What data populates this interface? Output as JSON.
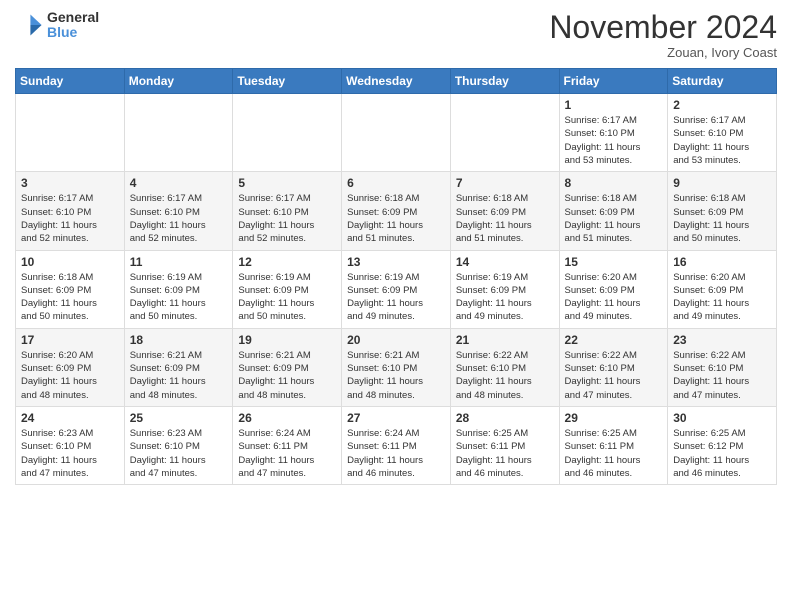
{
  "header": {
    "logo_general": "General",
    "logo_blue": "Blue",
    "month_title": "November 2024",
    "location": "Zouan, Ivory Coast"
  },
  "days_of_week": [
    "Sunday",
    "Monday",
    "Tuesday",
    "Wednesday",
    "Thursday",
    "Friday",
    "Saturday"
  ],
  "weeks": [
    [
      {
        "day": "",
        "info": ""
      },
      {
        "day": "",
        "info": ""
      },
      {
        "day": "",
        "info": ""
      },
      {
        "day": "",
        "info": ""
      },
      {
        "day": "",
        "info": ""
      },
      {
        "day": "1",
        "info": "Sunrise: 6:17 AM\nSunset: 6:10 PM\nDaylight: 11 hours\nand 53 minutes."
      },
      {
        "day": "2",
        "info": "Sunrise: 6:17 AM\nSunset: 6:10 PM\nDaylight: 11 hours\nand 53 minutes."
      }
    ],
    [
      {
        "day": "3",
        "info": "Sunrise: 6:17 AM\nSunset: 6:10 PM\nDaylight: 11 hours\nand 52 minutes."
      },
      {
        "day": "4",
        "info": "Sunrise: 6:17 AM\nSunset: 6:10 PM\nDaylight: 11 hours\nand 52 minutes."
      },
      {
        "day": "5",
        "info": "Sunrise: 6:17 AM\nSunset: 6:10 PM\nDaylight: 11 hours\nand 52 minutes."
      },
      {
        "day": "6",
        "info": "Sunrise: 6:18 AM\nSunset: 6:09 PM\nDaylight: 11 hours\nand 51 minutes."
      },
      {
        "day": "7",
        "info": "Sunrise: 6:18 AM\nSunset: 6:09 PM\nDaylight: 11 hours\nand 51 minutes."
      },
      {
        "day": "8",
        "info": "Sunrise: 6:18 AM\nSunset: 6:09 PM\nDaylight: 11 hours\nand 51 minutes."
      },
      {
        "day": "9",
        "info": "Sunrise: 6:18 AM\nSunset: 6:09 PM\nDaylight: 11 hours\nand 50 minutes."
      }
    ],
    [
      {
        "day": "10",
        "info": "Sunrise: 6:18 AM\nSunset: 6:09 PM\nDaylight: 11 hours\nand 50 minutes."
      },
      {
        "day": "11",
        "info": "Sunrise: 6:19 AM\nSunset: 6:09 PM\nDaylight: 11 hours\nand 50 minutes."
      },
      {
        "day": "12",
        "info": "Sunrise: 6:19 AM\nSunset: 6:09 PM\nDaylight: 11 hours\nand 50 minutes."
      },
      {
        "day": "13",
        "info": "Sunrise: 6:19 AM\nSunset: 6:09 PM\nDaylight: 11 hours\nand 49 minutes."
      },
      {
        "day": "14",
        "info": "Sunrise: 6:19 AM\nSunset: 6:09 PM\nDaylight: 11 hours\nand 49 minutes."
      },
      {
        "day": "15",
        "info": "Sunrise: 6:20 AM\nSunset: 6:09 PM\nDaylight: 11 hours\nand 49 minutes."
      },
      {
        "day": "16",
        "info": "Sunrise: 6:20 AM\nSunset: 6:09 PM\nDaylight: 11 hours\nand 49 minutes."
      }
    ],
    [
      {
        "day": "17",
        "info": "Sunrise: 6:20 AM\nSunset: 6:09 PM\nDaylight: 11 hours\nand 48 minutes."
      },
      {
        "day": "18",
        "info": "Sunrise: 6:21 AM\nSunset: 6:09 PM\nDaylight: 11 hours\nand 48 minutes."
      },
      {
        "day": "19",
        "info": "Sunrise: 6:21 AM\nSunset: 6:09 PM\nDaylight: 11 hours\nand 48 minutes."
      },
      {
        "day": "20",
        "info": "Sunrise: 6:21 AM\nSunset: 6:10 PM\nDaylight: 11 hours\nand 48 minutes."
      },
      {
        "day": "21",
        "info": "Sunrise: 6:22 AM\nSunset: 6:10 PM\nDaylight: 11 hours\nand 48 minutes."
      },
      {
        "day": "22",
        "info": "Sunrise: 6:22 AM\nSunset: 6:10 PM\nDaylight: 11 hours\nand 47 minutes."
      },
      {
        "day": "23",
        "info": "Sunrise: 6:22 AM\nSunset: 6:10 PM\nDaylight: 11 hours\nand 47 minutes."
      }
    ],
    [
      {
        "day": "24",
        "info": "Sunrise: 6:23 AM\nSunset: 6:10 PM\nDaylight: 11 hours\nand 47 minutes."
      },
      {
        "day": "25",
        "info": "Sunrise: 6:23 AM\nSunset: 6:10 PM\nDaylight: 11 hours\nand 47 minutes."
      },
      {
        "day": "26",
        "info": "Sunrise: 6:24 AM\nSunset: 6:11 PM\nDaylight: 11 hours\nand 47 minutes."
      },
      {
        "day": "27",
        "info": "Sunrise: 6:24 AM\nSunset: 6:11 PM\nDaylight: 11 hours\nand 46 minutes."
      },
      {
        "day": "28",
        "info": "Sunrise: 6:25 AM\nSunset: 6:11 PM\nDaylight: 11 hours\nand 46 minutes."
      },
      {
        "day": "29",
        "info": "Sunrise: 6:25 AM\nSunset: 6:11 PM\nDaylight: 11 hours\nand 46 minutes."
      },
      {
        "day": "30",
        "info": "Sunrise: 6:25 AM\nSunset: 6:12 PM\nDaylight: 11 hours\nand 46 minutes."
      }
    ]
  ]
}
